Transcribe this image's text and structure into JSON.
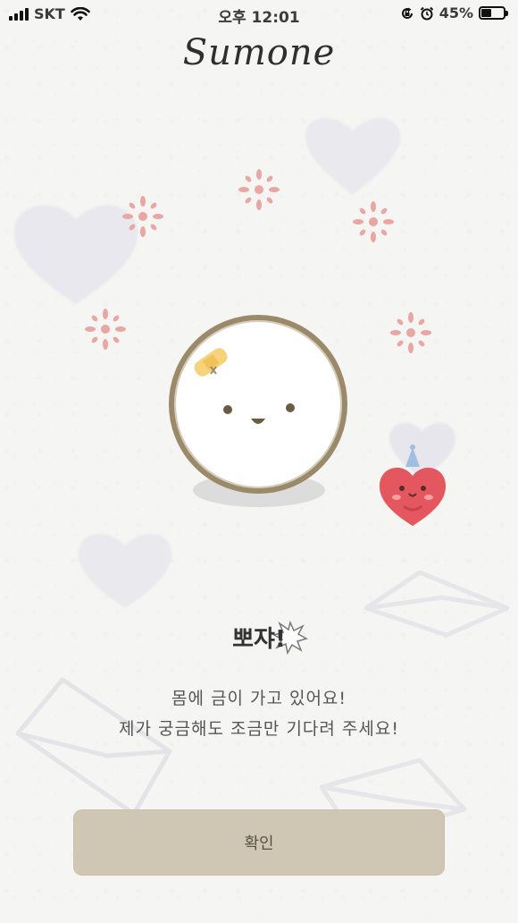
{
  "status_bar": {
    "carrier": "SKT",
    "time": "오후 12:01",
    "battery_percent": "45%",
    "battery_level": 0.45,
    "icons": [
      "signal-icon",
      "wifi-icon",
      "rotation-lock-icon",
      "alarm-icon",
      "battery-icon"
    ]
  },
  "header": {
    "logo": "Sumone"
  },
  "dialog": {
    "title": "뽀쟈!",
    "message_line1": "몸에 금이 가고 있어요!",
    "message_line2": "제가 궁금해도 조금만 기다려 주세요!"
  },
  "actions": {
    "confirm_label": "확인"
  },
  "colors": {
    "background": "#f5f5f4",
    "button": "#cfc6b3",
    "heart_character": "#e4575f",
    "sparkle": "#e9a8a4"
  }
}
